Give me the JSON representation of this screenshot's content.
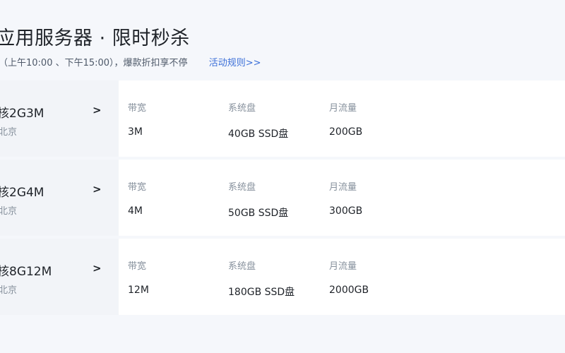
{
  "header": {
    "title": "应用服务器 · 限时秒杀",
    "subtitle": "（上午10:00 、下午15:00），爆款折扣享不停",
    "rules_link": "活动规则>>"
  },
  "products": [
    {
      "spec": "核2G3M",
      "region": "北京",
      "chevron_icon": "chevron-right-icon",
      "fields": [
        {
          "label": "带宽",
          "value": "3M"
        },
        {
          "label": "系统盘",
          "value": "40GB SSD盘"
        },
        {
          "label": "月流量",
          "value": "200GB"
        }
      ]
    },
    {
      "spec": "核2G4M",
      "region": "北京",
      "chevron_icon": "chevron-right-icon",
      "fields": [
        {
          "label": "带宽",
          "value": "4M"
        },
        {
          "label": "系统盘",
          "value": "50GB SSD盘"
        },
        {
          "label": "月流量",
          "value": "300GB"
        }
      ]
    },
    {
      "spec": "核8G12M",
      "region": "北京",
      "chevron_icon": "chevron-right-icon",
      "fields": [
        {
          "label": "带宽",
          "value": "12M"
        },
        {
          "label": "系统盘",
          "value": "180GB SSD盘"
        },
        {
          "label": "月流量",
          "value": "2000GB"
        }
      ]
    }
  ],
  "chevron_glyph": ">",
  "colors": {
    "link": "#3b6fd8",
    "background": "#f5f7fb",
    "card_left": "#f2f4f8",
    "card_right": "#ffffff"
  }
}
